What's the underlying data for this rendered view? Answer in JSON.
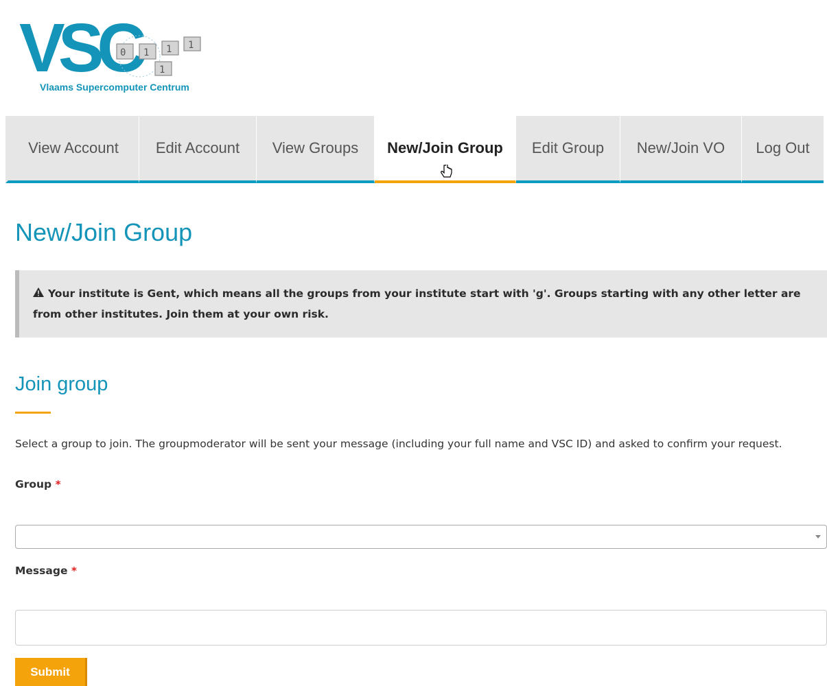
{
  "logo": {
    "text": "VSC",
    "subtitle": "Vlaams Supercomputer Centrum",
    "brand_color": "#1394b8"
  },
  "nav": {
    "tabs": [
      {
        "label": "View Account",
        "active": false
      },
      {
        "label": "Edit Account",
        "active": false
      },
      {
        "label": "View Groups",
        "active": false
      },
      {
        "label": "New/Join Group",
        "active": true
      },
      {
        "label": "Edit Group",
        "active": false
      },
      {
        "label": "New/Join VO",
        "active": false
      },
      {
        "label": "Log Out",
        "active": false
      }
    ],
    "accent_color": "#0d9cc1",
    "active_color": "#f5a30b"
  },
  "page": {
    "title": "New/Join Group"
  },
  "alert": {
    "icon": "warning-triangle-icon",
    "text": "Your institute is Gent, which means all the groups from your institute start with 'g'. Groups starting with any other letter are from other institutes. Join them at your own risk."
  },
  "join_section": {
    "title": "Join group",
    "intro": "Select a group to join. The groupmoderator will be sent your message (including your full name and VSC ID) and asked to confirm your request.",
    "group_label": "Group",
    "group_value": "",
    "message_label": "Message",
    "message_value": "",
    "required_marker": "*",
    "submit_label": "Submit"
  }
}
